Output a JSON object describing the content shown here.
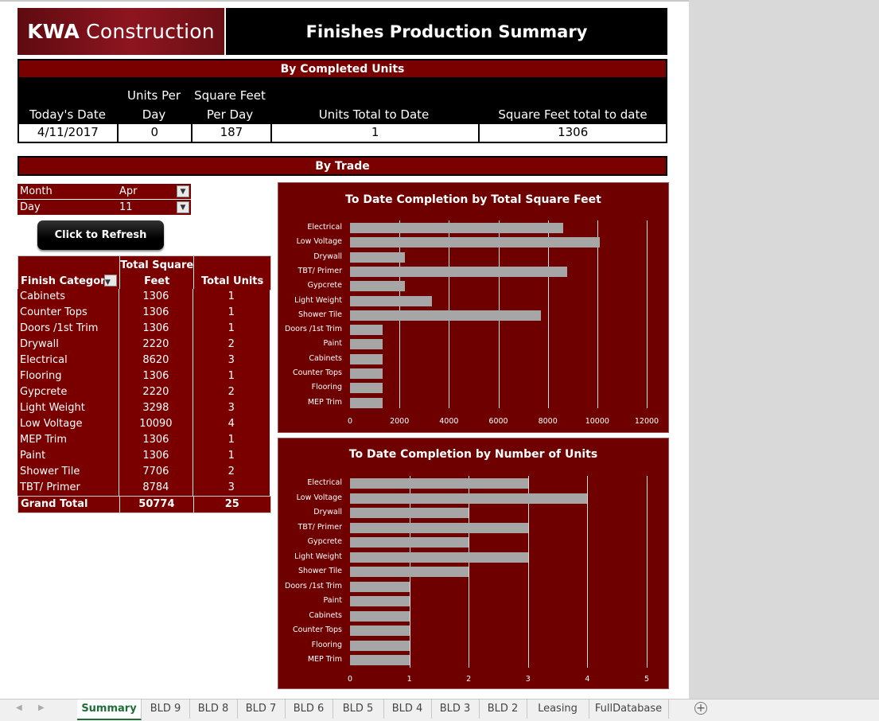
{
  "header": {
    "logo_bold": "KWA",
    "logo_rest": "Construction",
    "title": "Finishes Production Summary"
  },
  "completed": {
    "section_title": "By Completed Units",
    "columns": [
      {
        "h1": "",
        "h2": "Today's Date"
      },
      {
        "h1": "Units Per",
        "h2": "Day"
      },
      {
        "h1": "Square Feet",
        "h2": "Per Day"
      },
      {
        "h1": "",
        "h2": "Units Total to Date"
      },
      {
        "h1": "",
        "h2": "Square Feet total to date"
      }
    ],
    "values": [
      "4/11/2017",
      "0",
      "187",
      "1",
      "1306"
    ]
  },
  "trade": {
    "section_title": "By Trade",
    "filters": [
      {
        "label": "Month",
        "value": "Apr"
      },
      {
        "label": "Day",
        "value": "11"
      }
    ],
    "refresh_label": "Click to Refresh",
    "table": {
      "headers": {
        "category": "Finish Category",
        "sqft_1": "Total Square",
        "sqft_2": "Feet",
        "units": "Total Units"
      },
      "rows": [
        [
          "Cabinets",
          "1306",
          "1"
        ],
        [
          "Counter Tops",
          "1306",
          "1"
        ],
        [
          "Doors /1st Trim",
          "1306",
          "1"
        ],
        [
          "Drywall",
          "2220",
          "2"
        ],
        [
          "Electrical",
          "8620",
          "3"
        ],
        [
          "Flooring",
          "1306",
          "1"
        ],
        [
          "Gypcrete",
          "2220",
          "2"
        ],
        [
          "Light Weight",
          "3298",
          "3"
        ],
        [
          "Low Voltage",
          "10090",
          "4"
        ],
        [
          "MEP Trim",
          "1306",
          "1"
        ],
        [
          "Paint",
          "1306",
          "1"
        ],
        [
          "Shower Tile",
          "7706",
          "2"
        ],
        [
          "TBT/ Primer",
          "8784",
          "3"
        ]
      ],
      "total": [
        "Grand Total",
        "50774",
        "25"
      ]
    }
  },
  "chart_data": [
    {
      "type": "bar",
      "title": "To Date Completion by Total Square Feet",
      "categories": [
        "Electrical",
        "Low Voltage",
        "Drywall",
        "TBT/ Primer",
        "Gypcrete",
        "Light Weight",
        "Shower Tile",
        "Doors /1st Trim",
        "Paint",
        "Cabinets",
        "Counter Tops",
        "Flooring",
        "MEP Trim"
      ],
      "values": [
        8620,
        10090,
        2220,
        8784,
        2220,
        3298,
        7706,
        1306,
        1306,
        1306,
        1306,
        1306,
        1306
      ],
      "xlim": [
        0,
        12000
      ],
      "ticks": [
        "0",
        "2000",
        "4000",
        "6000",
        "8000",
        "10000",
        "12000"
      ],
      "grid": true,
      "bar_color": "#a6a6a6",
      "background": "#6e0000"
    },
    {
      "type": "bar",
      "title": "To Date Completion by Number of Units",
      "categories": [
        "Electrical",
        "Low Voltage",
        "Drywall",
        "TBT/ Primer",
        "Gypcrete",
        "Light Weight",
        "Shower Tile",
        "Doors /1st Trim",
        "Paint",
        "Cabinets",
        "Counter Tops",
        "Flooring",
        "MEP Trim"
      ],
      "values": [
        3,
        4,
        2,
        3,
        2,
        3,
        2,
        1,
        1,
        1,
        1,
        1,
        1
      ],
      "xlim": [
        0,
        5
      ],
      "ticks": [
        "0",
        "1",
        "2",
        "3",
        "4",
        "5"
      ],
      "grid": true,
      "bar_color": "#a6a6a6",
      "background": "#6e0000"
    }
  ],
  "tabs": [
    "Summary",
    "BLD 9",
    "BLD 8",
    "BLD 7",
    "BLD 6",
    "BLD 5",
    "BLD 4",
    "BLD 3",
    "BLD 2",
    "Leasing",
    "FullDatabase"
  ],
  "active_tab": "Summary",
  "colors": {
    "accent": "#7a0000",
    "chart_bg": "#6e0000",
    "bar": "#a6a6a6"
  }
}
